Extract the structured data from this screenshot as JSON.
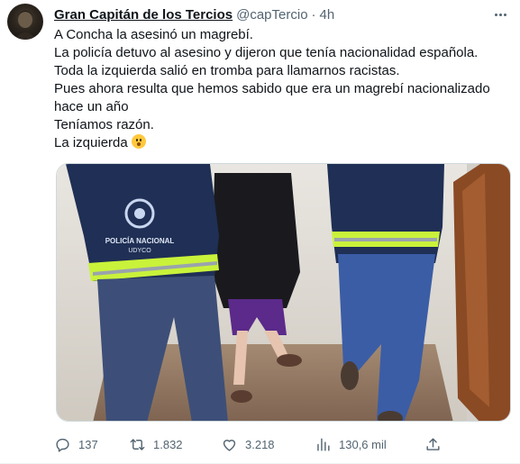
{
  "tweet": {
    "author_name": "Gran Capitán de los Tercios",
    "handle": "@capTercio",
    "separator": "·",
    "time": "4h",
    "lines": [
      "A Concha la asesinó un magrebí.",
      "La policía detuvo al asesino y dijeron que tenía nacionalidad española.",
      "Toda la izquierda salió en tromba para llamarnos racistas.",
      "Pues ahora resulta que hemos sabido que era un magrebí nacionalizado",
      "hace un año",
      "Teníamos razón.",
      "La izquierda"
    ],
    "emoji": "face-with-hand-over-mouth",
    "media": {
      "vest_text_line1": "POLICÍA NACIONAL",
      "vest_text_line2": "UDYCO"
    }
  },
  "actions": {
    "replies": "137",
    "retweets": "1.832",
    "likes": "3.218",
    "views": "130,6 mil"
  },
  "icons": [
    "more-icon",
    "reply-icon",
    "retweet-icon",
    "like-icon",
    "views-icon",
    "share-icon"
  ],
  "colors": {
    "text": "#0f1419",
    "secondary": "#536471",
    "border": "#cfd9de",
    "vest_yellow": "#c9f23a",
    "vest_navy": "#1f2f55"
  }
}
